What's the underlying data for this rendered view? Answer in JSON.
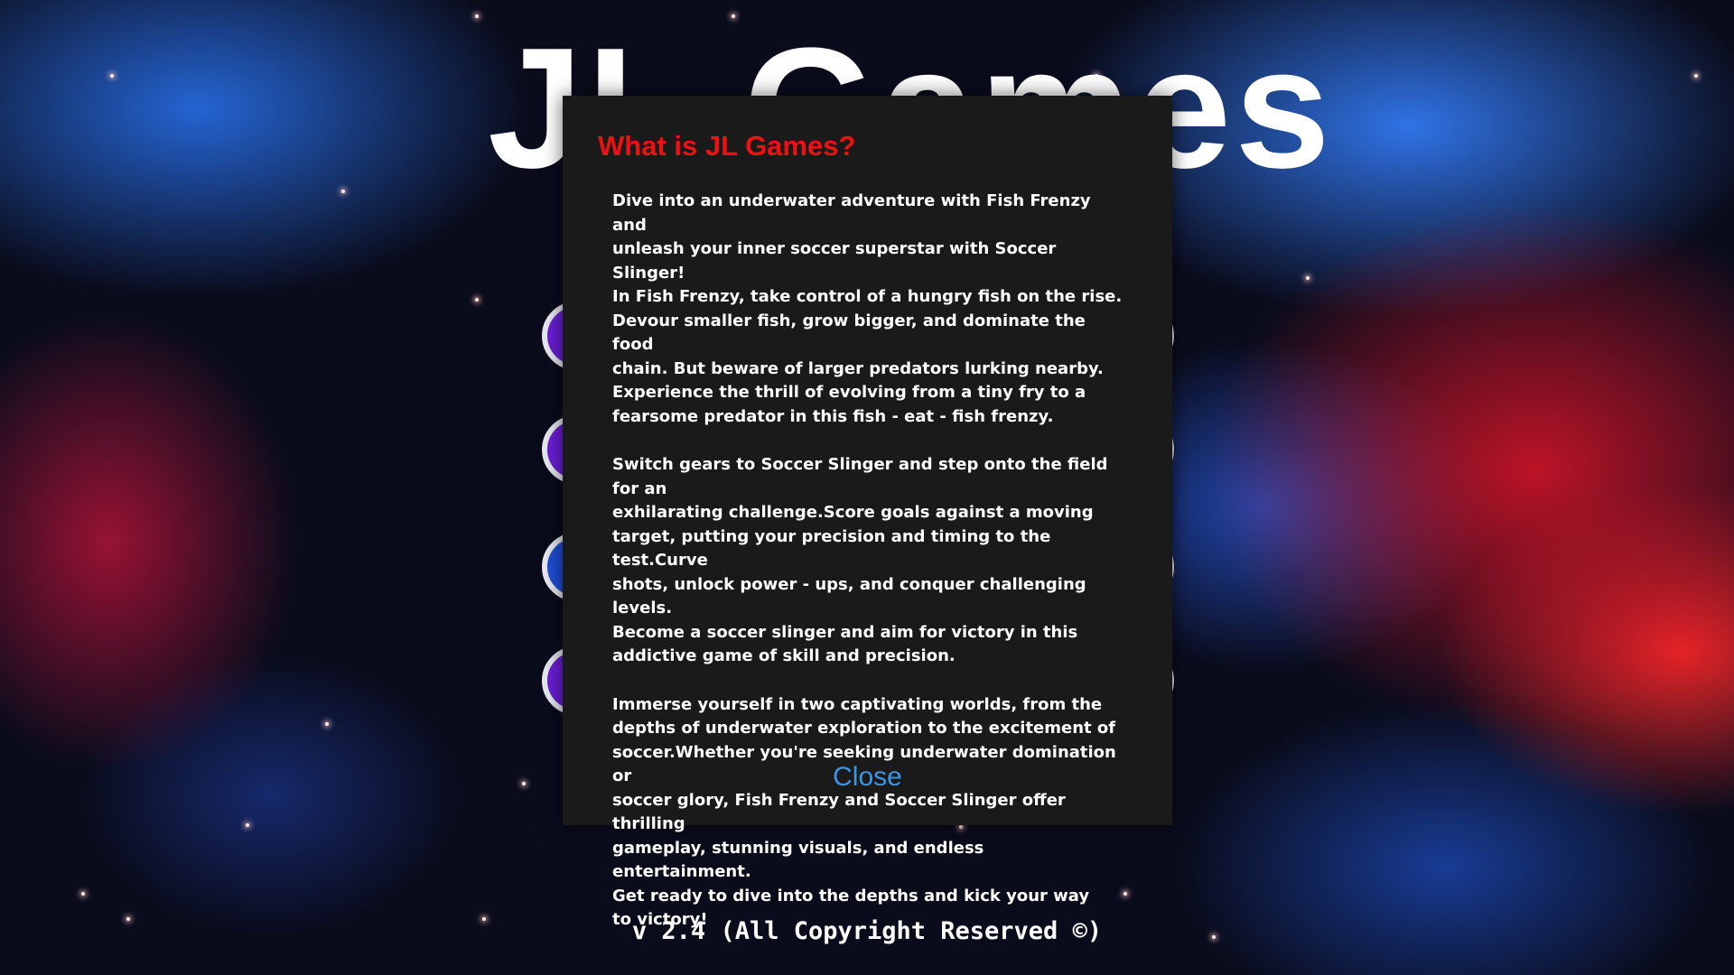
{
  "background": {
    "app_title": "JL Games"
  },
  "modal": {
    "title": "What is JL Games?",
    "paragraphs": [
      "Dive into an underwater adventure with Fish Frenzy and\nunleash your inner soccer superstar with Soccer Slinger!\nIn Fish Frenzy, take control of a hungry fish on the rise.\nDevour smaller fish, grow bigger, and dominate the food\nchain. But beware of larger predators lurking nearby.\nExperience the thrill of evolving from a tiny fry to a\nfearsome predator in this fish - eat - fish frenzy.",
      "Switch gears to Soccer Slinger and step onto the field for an\nexhilarating challenge.Score goals against a moving\ntarget, putting your precision and timing to the test.Curve\nshots, unlock power - ups, and conquer challenging levels.\nBecome a soccer slinger and aim for victory in this\naddictive game of skill and precision.",
      "Immerse yourself in two captivating worlds, from the\ndepths of underwater exploration to the excitement of\nsoccer.Whether you're seeking underwater domination or\nsoccer glory, Fish Frenzy and Soccer Slinger offer thrilling\ngameplay, stunning visuals, and endless entertainment.\nGet ready to dive into the depths and kick your way\nto victory!"
    ],
    "close_label": "Close"
  },
  "footer": {
    "version_text": "v 2.4 (All Copyright Reserved ©)"
  },
  "colors": {
    "modal_title": "#ee1111",
    "close_link": "#3a96e8",
    "modal_bg": "#1a1a1a"
  }
}
